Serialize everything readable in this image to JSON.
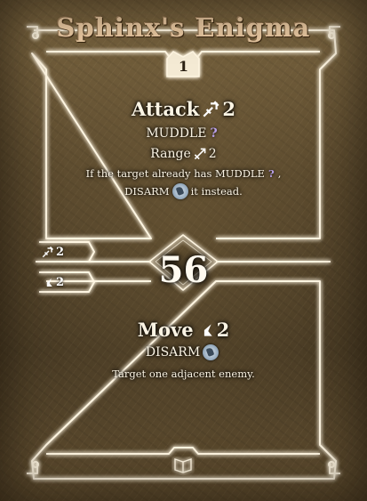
{
  "card": {
    "title": "Sphinx's Enigma",
    "level": "1",
    "initiative": "56",
    "summary_tabs": [
      {
        "icon": "attack-icon",
        "value": "2"
      },
      {
        "icon": "move-icon",
        "value": "2"
      }
    ],
    "top_action": {
      "attack_label": "Attack",
      "attack_value": "2",
      "condition": "MUDDLE",
      "range_label": "Range",
      "range_value": "2",
      "note_line1_prefix": "If the target already has MUDDLE",
      "note_line1_suffix": ",",
      "note_line2_prefix": "DISARM",
      "note_line2_suffix": "it instead."
    },
    "bottom_action": {
      "move_label": "Move",
      "move_value": "2",
      "condition": "DISARM",
      "note": "Target one adjacent enemy."
    },
    "colors": {
      "frame_glow": "#fff3d6",
      "parchment": "#5b4a2e",
      "muddle": "#b9a0e8",
      "disarm": "#8ea4b8"
    }
  }
}
